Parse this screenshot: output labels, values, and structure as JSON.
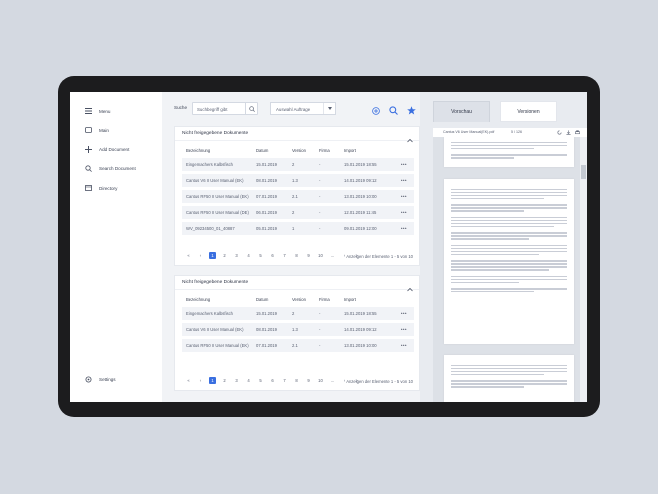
{
  "sidebar": {
    "items": [
      {
        "label": "Menu",
        "icon": "hamburger-icon"
      },
      {
        "label": "Main",
        "icon": "folder-icon"
      },
      {
        "label": "Add Document",
        "icon": "plus-icon"
      },
      {
        "label": "Search Document",
        "icon": "search-icon"
      },
      {
        "label": "Directory",
        "icon": "directory-icon"
      }
    ],
    "settings": {
      "label": "Settings",
      "icon": "gear-icon"
    }
  },
  "toolbar": {
    "search_label": "Suche",
    "search_value": "Suchbegriff gibt",
    "select_value": "Auswahl Auftrage"
  },
  "colors": {
    "accent": "#3a6fe0",
    "sidebar": "#ffffff",
    "row": "#f1f3f7"
  },
  "panel1": {
    "title": "Nicht freigegebene Dokumente",
    "columns": [
      "Bezeichnung",
      "Datum",
      "Version",
      "Firma",
      "Import"
    ],
    "rows": [
      {
        "name": "Eingemachers Kalbsfisch",
        "date": "15.01.2019",
        "version": "2",
        "firma": "-",
        "import": "15.01.2019 18:55"
      },
      {
        "name": "Cantus V6 II User Manual (EK)",
        "date": "08.01.2019",
        "version": "1.3",
        "firma": "-",
        "import": "14.01.2019 09:12"
      },
      {
        "name": "Cantus RF50 II User Manual (EK)",
        "date": "07.01.2019",
        "version": "2.1",
        "firma": "-",
        "import": "13.01.2019 10:00"
      },
      {
        "name": "Cantus RF50 II User Manual (DE)",
        "date": "06.01.2019",
        "version": "2",
        "firma": "-",
        "import": "12.01.2019 11:45"
      },
      {
        "name": "WV_09234500_01_40887",
        "date": "05.01.2019",
        "version": "1",
        "firma": "-",
        "import": "09.01.2019 12:00"
      }
    ],
    "pager": [
      "«",
      "‹",
      "1",
      "2",
      "3",
      "4",
      "5",
      "6",
      "7",
      "8",
      "9",
      "10",
      "...",
      "›",
      "»"
    ],
    "pager_info": "Anzeigen der Elemente 1 - 5 von 10"
  },
  "panel2": {
    "title": "Nicht freigegebene Dokumente",
    "columns": [
      "Bezeichnung",
      "Datum",
      "Version",
      "Firma",
      "Import"
    ],
    "rows": [
      {
        "name": "Eingemachers Kalbsfisch",
        "date": "15.01.2019",
        "version": "2",
        "firma": "-",
        "import": "15.01.2019 18:55"
      },
      {
        "name": "Cantus V6 II User Manual (EK)",
        "date": "08.01.2019",
        "version": "1.3",
        "firma": "-",
        "import": "14.01.2019 09:12"
      },
      {
        "name": "Cantus RF50 II User Manual (EK)",
        "date": "07.01.2019",
        "version": "2.1",
        "firma": "-",
        "import": "13.01.2019 10:00"
      }
    ],
    "pager": [
      "«",
      "‹",
      "1",
      "2",
      "3",
      "4",
      "5",
      "6",
      "7",
      "8",
      "9",
      "10",
      "...",
      "›",
      "»"
    ],
    "pager_info": "Anzeigen der Elemente 1 - 5 von 10"
  },
  "preview": {
    "tabs": [
      "Vorschau",
      "Versionen"
    ],
    "filename": "Cantus V6 User Manual(EK).pdf",
    "page_info": "5 / 126"
  }
}
